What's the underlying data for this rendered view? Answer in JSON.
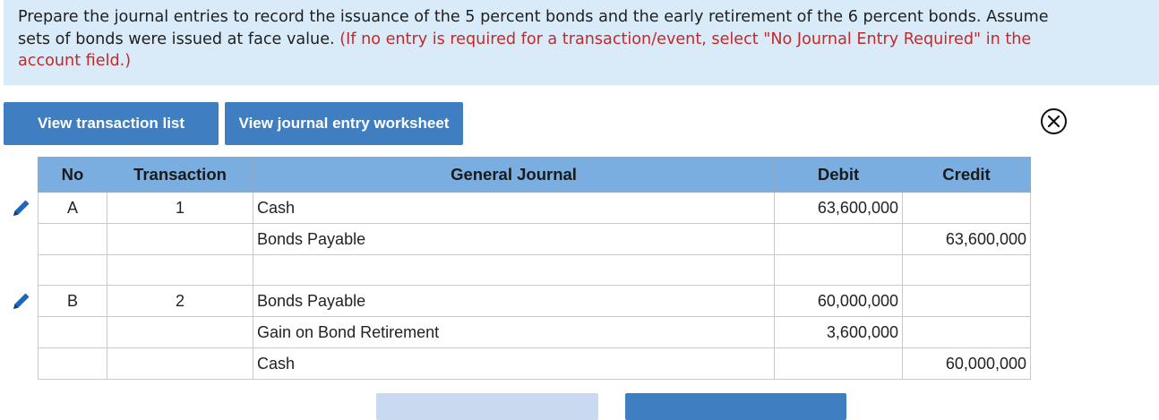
{
  "instructions": {
    "line1": "Prepare the journal entries to record the issuance of the 5 percent bonds and the early retirement of the 6 percent bonds. Assume",
    "line2_black": "sets of bonds were issued at face value.",
    "line2_red": "(If no entry is required for a transaction/event, select \"No Journal Entry Required\" in the",
    "line3_red": "account field.)"
  },
  "buttons": {
    "transaction_list": "View transaction list",
    "journal_worksheet": "View journal entry worksheet"
  },
  "table": {
    "headers": {
      "no": "No",
      "transaction": "Transaction",
      "general_journal": "General Journal",
      "debit": "Debit",
      "credit": "Credit"
    },
    "rows": [
      {
        "no": "A",
        "transaction": "1",
        "account": "Cash",
        "debit": "63,600,000",
        "credit": ""
      },
      {
        "no": "",
        "transaction": "",
        "account": "Bonds Payable",
        "debit": "",
        "credit": "63,600,000"
      },
      {
        "no": "",
        "transaction": "",
        "account": "",
        "debit": "",
        "credit": ""
      },
      {
        "no": "B",
        "transaction": "2",
        "account": "Bonds Payable",
        "debit": "60,000,000",
        "credit": ""
      },
      {
        "no": "",
        "transaction": "",
        "account": "Gain on Bond Retirement",
        "debit": "3,600,000",
        "credit": ""
      },
      {
        "no": "",
        "transaction": "",
        "account": "Cash",
        "debit": "",
        "credit": "60,000,000"
      }
    ]
  },
  "icons": {
    "close": "close-circle-icon",
    "edit": "pencil-icon"
  },
  "colors": {
    "instruction_bg": "#d9ebf9",
    "instruction_red": "#c22a2a",
    "button_blue": "#3f7fc1",
    "header_blue": "#7aaee0"
  }
}
